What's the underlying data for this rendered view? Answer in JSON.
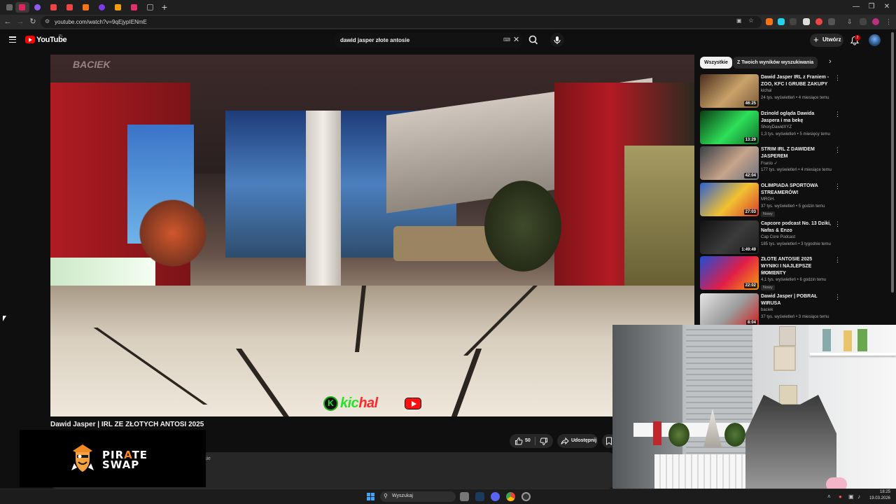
{
  "browser": {
    "url": "youtube.com/watch?v=9qEjypIENmE",
    "tab_colors": [
      "#e0245e",
      "#8b5cf6",
      "#ef4444",
      "#ef4444",
      "#f97316",
      "#7c3aed",
      "#f59e0b",
      "#e1306c",
      "#000000"
    ],
    "new_tab_label": "+",
    "window_buttons": [
      "—",
      "❐",
      "✕"
    ]
  },
  "youtube": {
    "wordmark": "YouTube",
    "country": "PL",
    "search_query": "dawid jasper złote antosie",
    "create_label": "Utwórz",
    "notification_count": "2"
  },
  "video": {
    "watermark": "BACIEK",
    "overlay_logo_text": "kichal",
    "title": "Dawid Jasper | IRL ZE ZŁOTYCH ANTOSI 2025",
    "like_count": "50",
    "share_label": "Udostępnij",
    "description_fragment": "sie"
  },
  "sponsor": {
    "line1": "PIRATE",
    "line2": "SWAP"
  },
  "sidebar": {
    "chips": [
      "Wszystkie",
      "Z Twoich wyników wyszukiwania"
    ],
    "recommendations": [
      {
        "title": "Dawid Jasper IRL z Franiem - ZOO, KFC I GRUBE ZAKUPY",
        "channel": "kichal",
        "meta": "24 tys. wyświetleń • 4 miesiące temu",
        "duration": "46:25",
        "badge": "",
        "verified": false,
        "thumb": [
          "#4a2e1c",
          "#c9a36a",
          "#7a5a3a"
        ]
      },
      {
        "title": "Dzinold ogląda Dawida Jaspera i ma bekę",
        "channel": "ShoryDawidXYZ",
        "meta": "1,3 tys. wyświetleń • 5 miesięcy temu",
        "duration": "13:29",
        "badge": "",
        "verified": false,
        "thumb": [
          "#0b3d12",
          "#2ee05a",
          "#0f6b2a"
        ]
      },
      {
        "title": "STRIM IRL Z DAWIDEM JASPEREM",
        "channel": "Franio",
        "meta": "177 tys. wyświetleń • 4 miesiące temu",
        "duration": "42:04",
        "badge": "",
        "verified": true,
        "thumb": [
          "#3a3f46",
          "#c7a48a",
          "#6b7280"
        ]
      },
      {
        "title": "OLIMPIADA SPORTOWA STREAMERÓW!",
        "channel": "MRGH.",
        "meta": "37 tys. wyświetleń • 5 godzin temu",
        "duration": "27:03",
        "badge": "Nowy",
        "verified": false,
        "thumb": [
          "#2d5fd3",
          "#f2c230",
          "#d33a2d"
        ]
      },
      {
        "title": "Capcore podcast No. 13 Dziki, Nafas & Enzo",
        "channel": "Cap Core Podcast",
        "meta": "185 tys. wyświetleń • 3 tygodnie temu",
        "duration": "1:49:49",
        "badge": "",
        "verified": false,
        "thumb": [
          "#121212",
          "#3b3b3b",
          "#1f1f1f"
        ]
      },
      {
        "title": "ZŁOTE ANTOSIE 2025 WYNIKI I NAJLEPSZE MOMENTY",
        "channel": "Szotopedia",
        "meta": "4,1 tys. wyświetleń • 6 godzin temu",
        "duration": "22:02",
        "badge": "Nowy",
        "verified": false,
        "thumb": [
          "#1d4ed8",
          "#e11d48",
          "#f59e0b"
        ]
      },
      {
        "title": "Dawid Jasper | POBRAŁ WIRUSA",
        "channel": "baciek",
        "meta": "37 tys. wyświetleń • 3 miesiące temu",
        "duration": "8:04",
        "badge": "",
        "verified": false,
        "thumb": [
          "#e5e5e5",
          "#9b9b9b",
          "#d61a1a"
        ]
      }
    ]
  },
  "taskbar": {
    "search_label": "Wyszukaj",
    "time": "18:25",
    "date": "19.03.2026"
  },
  "colors": {
    "youtube_red": "#ff0000",
    "chip_active_bg": "#f1f1f1",
    "chip_bg": "#272727",
    "kichal_green": "#2bde2b",
    "kichal_red": "#ff2a2a"
  }
}
